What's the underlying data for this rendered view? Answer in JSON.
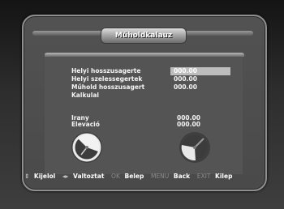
{
  "title": "Műholdkalauz",
  "fields": [
    {
      "label": "Helyi hosszusagerte",
      "value": "000.00",
      "selected": true
    },
    {
      "label": "Helyi szelessegertek",
      "value": "000.00",
      "selected": false
    },
    {
      "label": "Műhold hosszusagert",
      "value": "000.00",
      "selected": false
    }
  ],
  "calculate_label": "Kalkulal",
  "results": [
    {
      "label": "Irany",
      "value": "000.00"
    },
    {
      "label": "Elevació",
      "value": "000.00"
    }
  ],
  "footer": {
    "select_icon": "⇕",
    "select": "Kijelol",
    "change_icon": "◂▸",
    "change": "Valtoztat",
    "ok_key": "OK",
    "ok": "Belep",
    "menu_key": "MENU",
    "menu": "Back",
    "exit_key": "EXIT",
    "exit": "Kilep"
  },
  "icons": [
    "compass-dish-icon",
    "elevation-dish-icon"
  ]
}
